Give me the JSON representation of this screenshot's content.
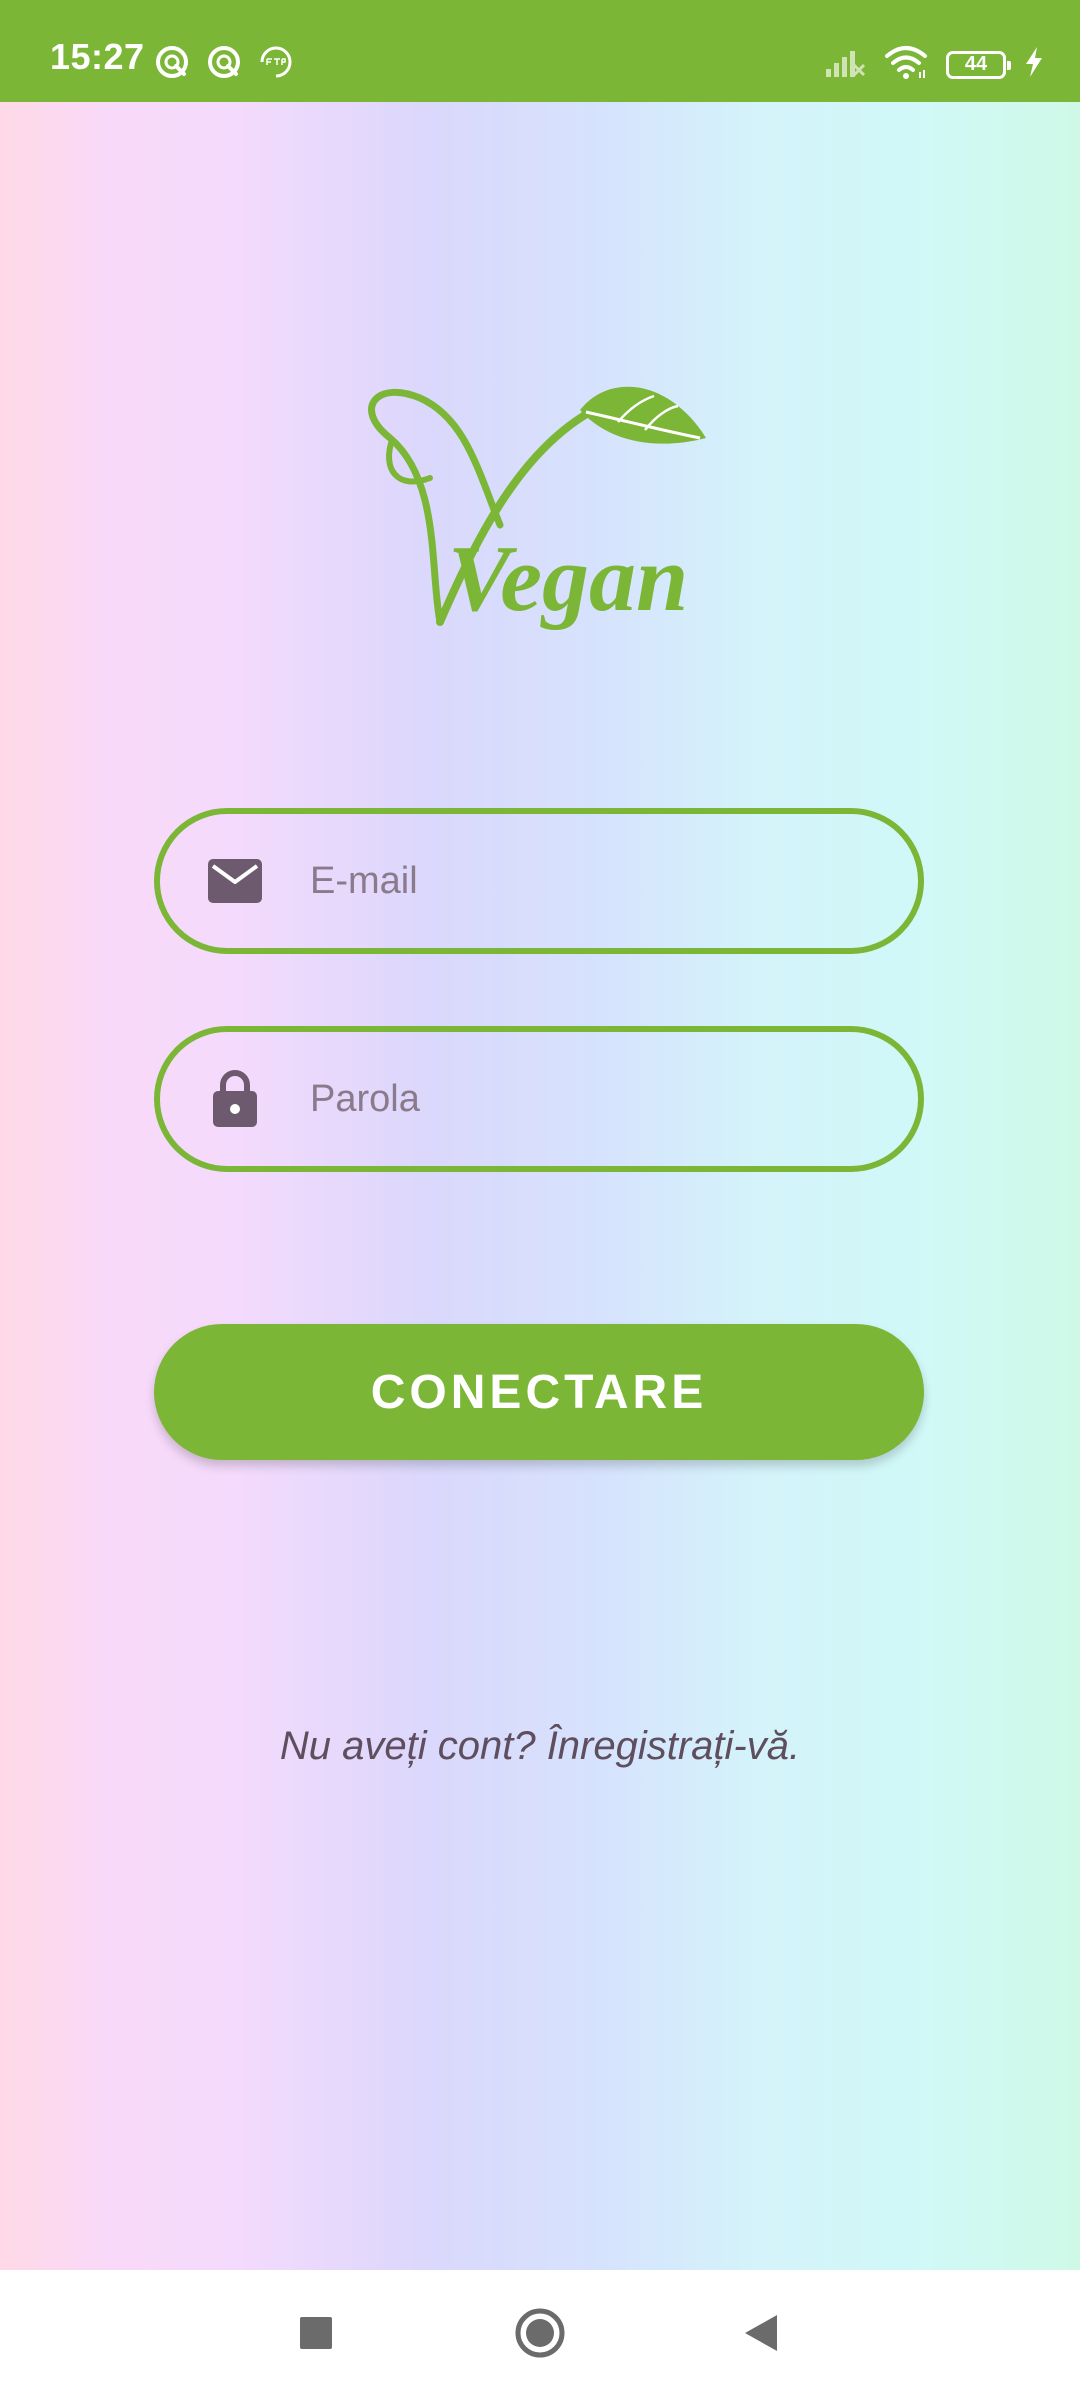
{
  "status_bar": {
    "time": "15:27",
    "battery_level": "44",
    "left_icons": [
      "sync-circle-icon",
      "sync-circle-icon",
      "ftp-icon"
    ],
    "right_icons": [
      "signal-off-icon",
      "wifi-icon",
      "battery-icon",
      "charging-bolt-icon"
    ]
  },
  "logo": {
    "text": "Vegan",
    "color": "#7CB637"
  },
  "form": {
    "email": {
      "placeholder": "E-mail",
      "value": "",
      "icon": "envelope-icon"
    },
    "password": {
      "placeholder": "Parola",
      "value": "",
      "icon": "lock-icon"
    },
    "submit_label": "CONECTARE",
    "register_text": "Nu aveți cont? Înregistrați-vă."
  },
  "nav": {
    "icons": [
      "recent-apps-icon",
      "home-icon",
      "back-icon"
    ]
  },
  "colors": {
    "accent": "#7CB637",
    "text_muted": "#5e4e5e",
    "icon": "#6e5a6e"
  }
}
